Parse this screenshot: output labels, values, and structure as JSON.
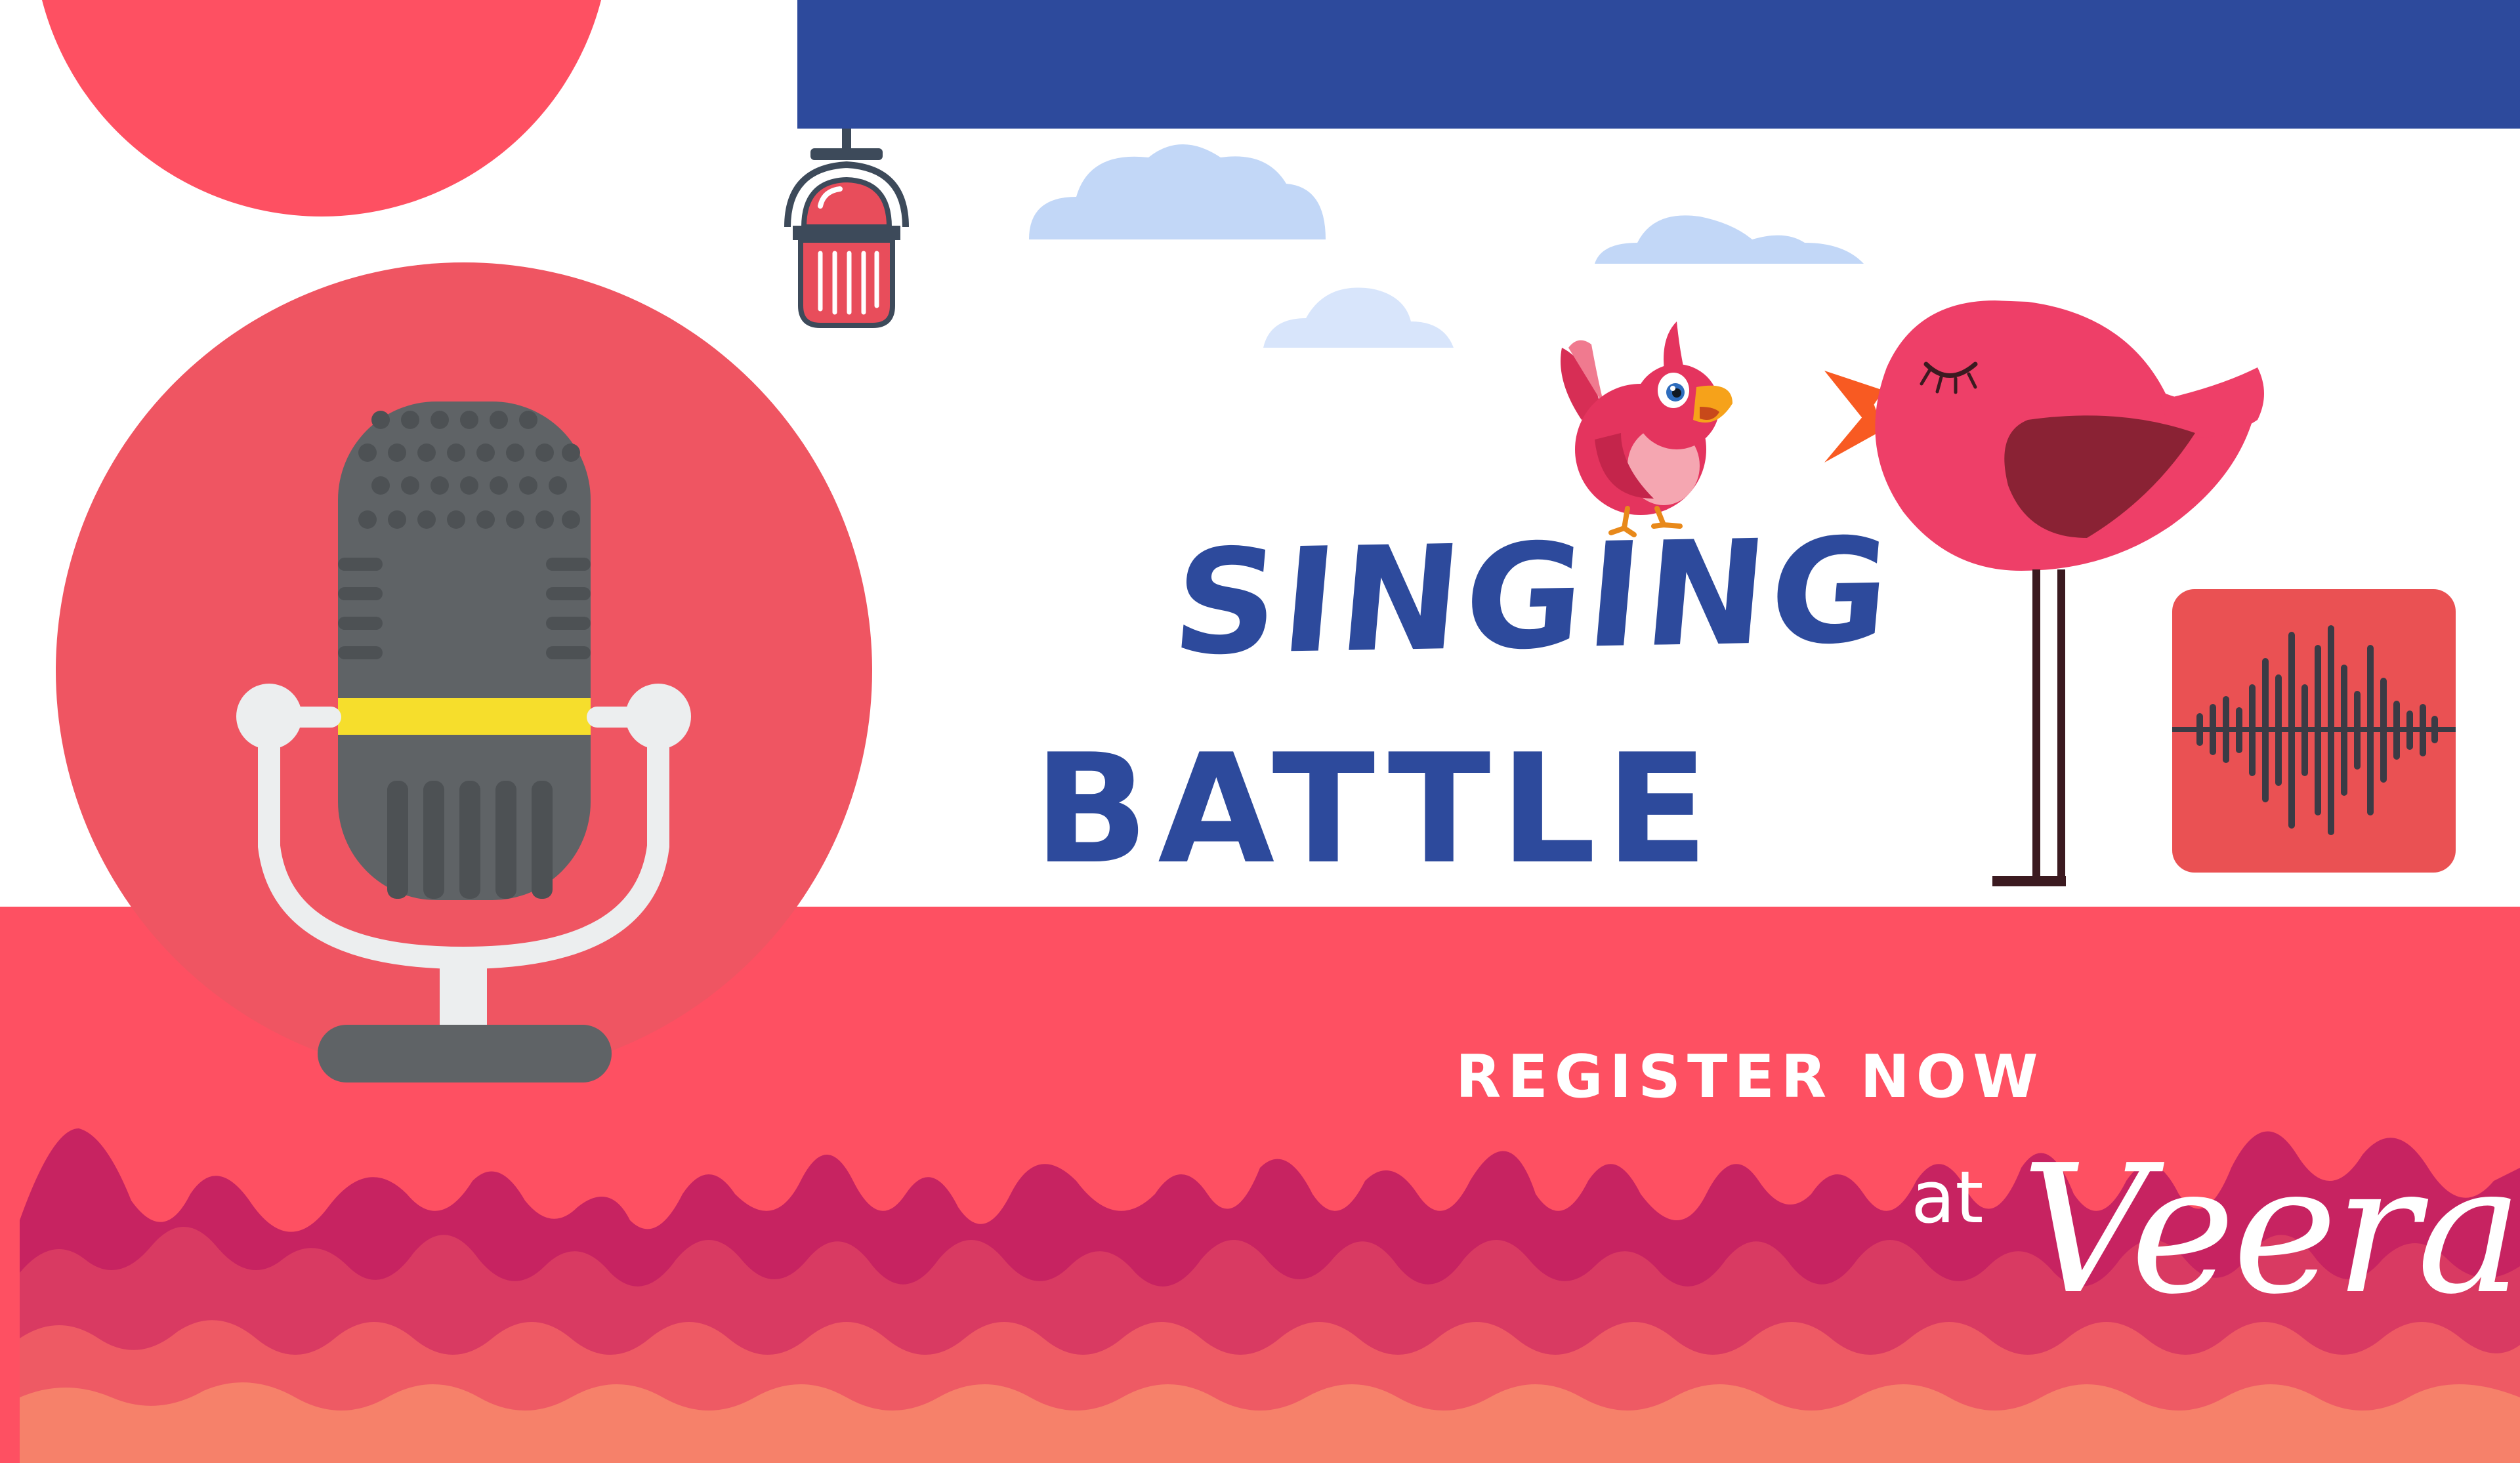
{
  "poster": {
    "title_line1": "SINGING",
    "title_line2": "BATTLE",
    "cta_line1": "REGISTER NOW",
    "cta_at": "at",
    "cta_brand": "Veera"
  },
  "icons": {
    "main": "vintage-microphone-icon",
    "hanging": "hanging-lamp-icon",
    "bird_small": "cartoon-bird-icon",
    "bird_large": "pink-bird-icon",
    "audio": "sound-wave-icon",
    "clouds": "cloud-icon"
  },
  "colors": {
    "coral": "#fe5062",
    "coral_circle": "#ef5562",
    "navy": "#2d4a9c",
    "title_blue": "#2d4a9c",
    "white": "#ffffff",
    "mic_grey": "#5f6366",
    "mic_band": "#f6de2c",
    "cloud_blue": "#c2d7f7",
    "wave_magenta": "#c72361",
    "wave_salmon": "#f6816a",
    "bird_pink": "#ee3f68",
    "bird_wing": "#8a2234",
    "bird_beak": "#f85a22",
    "audio_box": "#ea5153",
    "audio_wave": "#3b3b45"
  }
}
